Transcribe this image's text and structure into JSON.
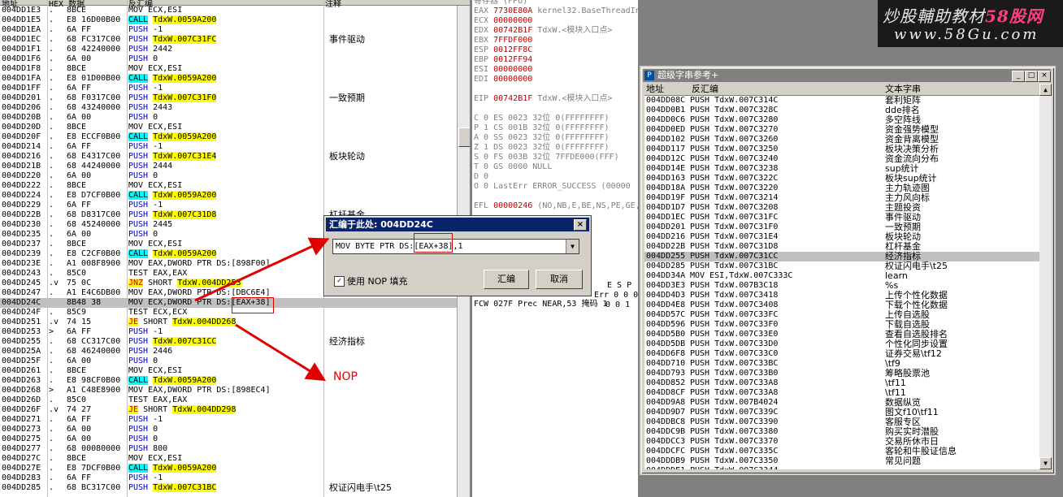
{
  "cpu": {
    "headers": [
      "地址",
      "HEX 数据",
      "反汇编",
      "注释"
    ],
    "rows": [
      {
        "addr": "004DD1E3",
        "flow": ".",
        "hex": "8BCE",
        "k": "",
        "op": "MOV ECX,ESI",
        "tgt": "",
        "c": ""
      },
      {
        "addr": "004DD1E5",
        "flow": ".",
        "hex": "E8 16D00B00",
        "k": "CALL",
        "op": "",
        "tgt": "TdxW.0059A200",
        "c": ""
      },
      {
        "addr": "004DD1EA",
        "flow": ".",
        "hex": "6A FF",
        "k": "PUSH",
        "op": " -1",
        "tgt": "",
        "c": ""
      },
      {
        "addr": "004DD1EC",
        "flow": ".",
        "hex": "68 FC317C00",
        "k": "PUSH",
        "op": "",
        "tgt": "TdxW.007C31FC",
        "c": "事件驱动"
      },
      {
        "addr": "004DD1F1",
        "flow": ".",
        "hex": "68 42240000",
        "k": "PUSH",
        "op": " 2442",
        "tgt": "",
        "c": ""
      },
      {
        "addr": "004DD1F6",
        "flow": ".",
        "hex": "6A 00",
        "k": "PUSH",
        "op": " 0",
        "tgt": "",
        "c": ""
      },
      {
        "addr": "004DD1F8",
        "flow": ".",
        "hex": "8BCE",
        "k": "",
        "op": "MOV ECX,ESI",
        "tgt": "",
        "c": ""
      },
      {
        "addr": "004DD1FA",
        "flow": ".",
        "hex": "E8 01D00B00",
        "k": "CALL",
        "op": "",
        "tgt": "TdxW.0059A200",
        "c": ""
      },
      {
        "addr": "004DD1FF",
        "flow": ".",
        "hex": "6A FF",
        "k": "PUSH",
        "op": " -1",
        "tgt": "",
        "c": ""
      },
      {
        "addr": "004DD201",
        "flow": ".",
        "hex": "68 F0317C00",
        "k": "PUSH",
        "op": "",
        "tgt": "TdxW.007C31F0",
        "c": "一致预期"
      },
      {
        "addr": "004DD206",
        "flow": ".",
        "hex": "68 43240000",
        "k": "PUSH",
        "op": " 2443",
        "tgt": "",
        "c": ""
      },
      {
        "addr": "004DD20B",
        "flow": ".",
        "hex": "6A 00",
        "k": "PUSH",
        "op": " 0",
        "tgt": "",
        "c": ""
      },
      {
        "addr": "004DD20D",
        "flow": ".",
        "hex": "8BCE",
        "k": "",
        "op": "MOV ECX,ESI",
        "tgt": "",
        "c": ""
      },
      {
        "addr": "004DD20F",
        "flow": ".",
        "hex": "E8 ECCF0B00",
        "k": "CALL",
        "op": "",
        "tgt": "TdxW.0059A200",
        "c": ""
      },
      {
        "addr": "004DD214",
        "flow": ".",
        "hex": "6A FF",
        "k": "PUSH",
        "op": " -1",
        "tgt": "",
        "c": ""
      },
      {
        "addr": "004DD216",
        "flow": ".",
        "hex": "68 E4317C00",
        "k": "PUSH",
        "op": "",
        "tgt": "TdxW.007C31E4",
        "c": "板块轮动"
      },
      {
        "addr": "004DD21B",
        "flow": ".",
        "hex": "68 44240000",
        "k": "PUSH",
        "op": " 2444",
        "tgt": "",
        "c": ""
      },
      {
        "addr": "004DD220",
        "flow": ".",
        "hex": "6A 00",
        "k": "PUSH",
        "op": " 0",
        "tgt": "",
        "c": ""
      },
      {
        "addr": "004DD222",
        "flow": ".",
        "hex": "8BCE",
        "k": "",
        "op": "MOV ECX,ESI",
        "tgt": "",
        "c": ""
      },
      {
        "addr": "004DD224",
        "flow": ".",
        "hex": "E8 D7CF0B00",
        "k": "CALL",
        "op": "",
        "tgt": "TdxW.0059A200",
        "c": ""
      },
      {
        "addr": "004DD229",
        "flow": ".",
        "hex": "6A FF",
        "k": "PUSH",
        "op": " -1",
        "tgt": "",
        "c": ""
      },
      {
        "addr": "004DD22B",
        "flow": ".",
        "hex": "68 D8317C00",
        "k": "PUSH",
        "op": "",
        "tgt": "TdxW.007C31D8",
        "c": "杠杆基金"
      },
      {
        "addr": "004DD230",
        "flow": ".",
        "hex": "68 45240000",
        "k": "PUSH",
        "op": " 2445",
        "tgt": "",
        "c": ""
      },
      {
        "addr": "004DD235",
        "flow": ".",
        "hex": "6A 00",
        "k": "PUSH",
        "op": " 0",
        "tgt": "",
        "c": ""
      },
      {
        "addr": "004DD237",
        "flow": ".",
        "hex": "8BCE",
        "k": "",
        "op": "MOV ECX,ESI",
        "tgt": "",
        "c": ""
      },
      {
        "addr": "004DD239",
        "flow": ".",
        "hex": "E8 C2CF0B00",
        "k": "CALL",
        "op": "",
        "tgt": "TdxW.0059A200",
        "c": ""
      },
      {
        "addr": "004DD23E",
        "flow": ".",
        "hex": "A1 008F8900",
        "k": "",
        "op": "MOV EAX,DWORD PTR DS:[898F00]",
        "tgt": "",
        "c": ""
      },
      {
        "addr": "004DD243",
        "flow": ".",
        "hex": "85C0",
        "k": "",
        "op": "TEST EAX,EAX",
        "tgt": "",
        "c": ""
      },
      {
        "addr": "004DD245",
        "flow": ".v",
        "hex": "75 0C",
        "k": "JNZ",
        "op": " SHORT",
        "tgt": "TdxW.004DD253",
        "c": ""
      },
      {
        "addr": "004DD247",
        "flow": ".",
        "hex": "A1 E4C6DB00",
        "k": "",
        "op": "MOV EAX,DWORD PTR DS:[DBC6E4]",
        "tgt": "",
        "c": ""
      },
      {
        "addr": "004DD24C",
        "flow": "",
        "hex": "8B48 38",
        "k": "",
        "op": "MOV ECX,DWORD PTR DS:[EAX+38]",
        "tgt": "",
        "c": "",
        "sel": true
      },
      {
        "addr": "004DD24F",
        "flow": ".",
        "hex": "85C9",
        "k": "",
        "op": "TEST ECX,ECX",
        "tgt": "",
        "c": ""
      },
      {
        "addr": "004DD251",
        "flow": ".v",
        "hex": "74 15",
        "k": "JE",
        "op": " SHORT",
        "tgt": "TdxW.004DD268",
        "c": ""
      },
      {
        "addr": "004DD253",
        "flow": ">",
        "hex": "6A FF",
        "k": "PUSH",
        "op": " -1",
        "tgt": "",
        "c": ""
      },
      {
        "addr": "004DD255",
        "flow": ".",
        "hex": "68 CC317C00",
        "k": "PUSH",
        "op": "",
        "tgt": "TdxW.007C31CC",
        "c": "经济指标"
      },
      {
        "addr": "004DD25A",
        "flow": ".",
        "hex": "68 46240000",
        "k": "PUSH",
        "op": " 2446",
        "tgt": "",
        "c": ""
      },
      {
        "addr": "004DD25F",
        "flow": ".",
        "hex": "6A 00",
        "k": "PUSH",
        "op": " 0",
        "tgt": "",
        "c": ""
      },
      {
        "addr": "004DD261",
        "flow": ".",
        "hex": "8BCE",
        "k": "",
        "op": "MOV ECX,ESI",
        "tgt": "",
        "c": ""
      },
      {
        "addr": "004DD263",
        "flow": ".",
        "hex": "E8 98CF0B00",
        "k": "CALL",
        "op": "",
        "tgt": "TdxW.0059A200",
        "c": ""
      },
      {
        "addr": "004DD268",
        "flow": ">",
        "hex": "A1 C48E8900",
        "k": "",
        "op": "MOV EAX,DWORD PTR DS:[898EC4]",
        "tgt": "",
        "c": ""
      },
      {
        "addr": "004DD26D",
        "flow": ".",
        "hex": "85C0",
        "k": "",
        "op": "TEST EAX,EAX",
        "tgt": "",
        "c": ""
      },
      {
        "addr": "004DD26F",
        "flow": ".v",
        "hex": "74 27",
        "k": "JE",
        "op": " SHORT",
        "tgt": "TdxW.004DD298",
        "c": ""
      },
      {
        "addr": "004DD271",
        "flow": ".",
        "hex": "6A FF",
        "k": "PUSH",
        "op": " -1",
        "tgt": "",
        "c": ""
      },
      {
        "addr": "004DD273",
        "flow": ".",
        "hex": "6A 00",
        "k": "PUSH",
        "op": " 0",
        "tgt": "",
        "c": ""
      },
      {
        "addr": "004DD275",
        "flow": ".",
        "hex": "6A 00",
        "k": "PUSH",
        "op": " 0",
        "tgt": "",
        "c": ""
      },
      {
        "addr": "004DD277",
        "flow": ".",
        "hex": "68 00080000",
        "k": "PUSH",
        "op": " 800",
        "tgt": "",
        "c": ""
      },
      {
        "addr": "004DD27C",
        "flow": ".",
        "hex": "8BCE",
        "k": "",
        "op": "MOV ECX,ESI",
        "tgt": "",
        "c": ""
      },
      {
        "addr": "004DD27E",
        "flow": ".",
        "hex": "E8 7DCF0B00",
        "k": "CALL",
        "op": "",
        "tgt": "TdxW.0059A200",
        "c": ""
      },
      {
        "addr": "004DD283",
        "flow": ".",
        "hex": "6A FF",
        "k": "PUSH",
        "op": " -1",
        "tgt": "",
        "c": ""
      },
      {
        "addr": "004DD285",
        "flow": ".",
        "hex": "68 BC317C00",
        "k": "PUSH",
        "op": "",
        "tgt": "TdxW.007C31BC",
        "c": "权证闪电手\\t25"
      }
    ]
  },
  "registers": {
    "title": "寄存器 (FPU)",
    "lines": [
      {
        "n": "EAX",
        "v": "7730E80A",
        "g": "kernel32.BaseThreadIn"
      },
      {
        "n": "ECX",
        "v": "00000000",
        "g": ""
      },
      {
        "n": "EDX",
        "v": "00742B1F",
        "g": "TdxW.<模块入口点>"
      },
      {
        "n": "EBX",
        "v": "7FFDF000",
        "g": ""
      },
      {
        "n": "ESP",
        "v": "0012FF8C",
        "g": ""
      },
      {
        "n": "EBP",
        "v": "0012FF94",
        "g": ""
      },
      {
        "n": "ESI",
        "v": "00000000",
        "g": ""
      },
      {
        "n": "EDI",
        "v": "00000000",
        "g": ""
      },
      {
        "n": "",
        "v": "",
        "g": ""
      },
      {
        "n": "EIP",
        "v": "00742B1F",
        "g": "TdxW.<模块入口点>"
      },
      {
        "n": "",
        "v": "",
        "g": ""
      },
      {
        "n": "C 0",
        "v": "",
        "g": "ES 0023 32位 0(FFFFFFFF)"
      },
      {
        "n": "P 1",
        "v": "",
        "g": "CS 001B 32位 0(FFFFFFFF)"
      },
      {
        "n": "A 0",
        "v": "",
        "g": "SS 0023 32位 0(FFFFFFFF)"
      },
      {
        "n": "Z 1",
        "v": "",
        "g": "DS 0023 32位 0(FFFFFFFF)"
      },
      {
        "n": "S 0",
        "v": "",
        "g": "FS 003B 32位 7FFDE000(FFF)"
      },
      {
        "n": "T 0",
        "v": "",
        "g": "GS 0000 NULL"
      },
      {
        "n": "D 0",
        "v": "",
        "g": ""
      },
      {
        "n": "O 0",
        "v": "",
        "g": "LastErr ERROR_SUCCESS (00000"
      },
      {
        "n": "",
        "v": "",
        "g": ""
      },
      {
        "n": "EFL",
        "v": "00000246",
        "g": "(NO,NB,E,BE,NS,PE,GE,"
      },
      {
        "n": "",
        "v": "",
        "g": ""
      },
      {
        "n": "ST0",
        "v": "",
        "g": "empty 0.0"
      }
    ],
    "partial1": "E S P",
    "partial2": "Err 0 0 0",
    "partial3": "0 0 1",
    "fcw": "FCW 027F  Prec NEAR,53  掩码    1"
  },
  "watermark": {
    "line1": "炒股輔助教材",
    "brand": "58股网",
    "line2": "www.58Gu.com"
  },
  "strings": {
    "title": "超级字串参考+",
    "headers": [
      "地址",
      "反汇编",
      "文本字串"
    ],
    "rows": [
      {
        "a": "004DD08C",
        "d": "PUSH TdxW.007C314C",
        "t": "套利矩阵"
      },
      {
        "a": "004DD0B1",
        "d": "PUSH TdxW.007C328C",
        "t": "dde排名"
      },
      {
        "a": "004DD0C6",
        "d": "PUSH TdxW.007C3280",
        "t": "多空阵线"
      },
      {
        "a": "004DD0ED",
        "d": "PUSH TdxW.007C3270",
        "t": "资金强势模型"
      },
      {
        "a": "004DD102",
        "d": "PUSH TdxW.007C3260",
        "t": "资金背离模型"
      },
      {
        "a": "004DD117",
        "d": "PUSH TdxW.007C3250",
        "t": "板块决策分析"
      },
      {
        "a": "004DD12C",
        "d": "PUSH TdxW.007C3240",
        "t": "资金流向分布"
      },
      {
        "a": "004DD14E",
        "d": "PUSH TdxW.007C3238",
        "t": "sup统计"
      },
      {
        "a": "004DD163",
        "d": "PUSH TdxW.007C322C",
        "t": "板块sup统计"
      },
      {
        "a": "004DD18A",
        "d": "PUSH TdxW.007C3220",
        "t": "主力轨迹图"
      },
      {
        "a": "004DD19F",
        "d": "PUSH TdxW.007C3214",
        "t": "主力风向标"
      },
      {
        "a": "004DD1D7",
        "d": "PUSH TdxW.007C3208",
        "t": "主题投资"
      },
      {
        "a": "004DD1EC",
        "d": "PUSH TdxW.007C31FC",
        "t": "事件驱动"
      },
      {
        "a": "004DD201",
        "d": "PUSH TdxW.007C31F0",
        "t": "一致预期"
      },
      {
        "a": "004DD216",
        "d": "PUSH TdxW.007C31E4",
        "t": "板块轮动"
      },
      {
        "a": "004DD22B",
        "d": "PUSH TdxW.007C31D8",
        "t": "杠杆基金"
      },
      {
        "a": "004DD255",
        "d": "PUSH TdxW.007C31CC",
        "t": "经济指标",
        "sel": true
      },
      {
        "a": "004DD285",
        "d": "PUSH TdxW.007C31BC",
        "t": "权证闪电手\\t25"
      },
      {
        "a": "004DD34A",
        "d": "MOV ESI,TdxW.007C333C",
        "t": "learn"
      },
      {
        "a": "004DD3E3",
        "d": "PUSH TdxW.007B3C18",
        "t": "%s"
      },
      {
        "a": "004DD4D3",
        "d": "PUSH TdxW.007C3418",
        "t": "上传个性化数据"
      },
      {
        "a": "004DD4E8",
        "d": "PUSH TdxW.007C3408",
        "t": "下载个性化数据"
      },
      {
        "a": "004DD57C",
        "d": "PUSH TdxW.007C33FC",
        "t": "上传自选股"
      },
      {
        "a": "004DD596",
        "d": "PUSH TdxW.007C33F0",
        "t": "下载自选股"
      },
      {
        "a": "004DD5B0",
        "d": "PUSH TdxW.007C33E0",
        "t": "查看自选股排名"
      },
      {
        "a": "004DD5DB",
        "d": "PUSH TdxW.007C33D0",
        "t": "个性化同步设置"
      },
      {
        "a": "004DD6F8",
        "d": "PUSH TdxW.007C33C0",
        "t": "证券交易\\tf12"
      },
      {
        "a": "004DD710",
        "d": "PUSH TdxW.007C33BC",
        "t": "\\tf9"
      },
      {
        "a": "004DD793",
        "d": "PUSH TdxW.007C33B0",
        "t": "筹略股票池"
      },
      {
        "a": "004DD852",
        "d": "PUSH TdxW.007C33A8",
        "t": "\\tf11"
      },
      {
        "a": "004DD8CF",
        "d": "PUSH TdxW.007C33A8",
        "t": "\\tf11"
      },
      {
        "a": "004DD9A8",
        "d": "PUSH TdxW.007B4024",
        "t": "数据纵览"
      },
      {
        "a": "004DD9D7",
        "d": "PUSH TdxW.007C339C",
        "t": "图文f10\\tf11"
      },
      {
        "a": "004DDBC8",
        "d": "PUSH TdxW.007C3390",
        "t": "客服专区"
      },
      {
        "a": "004DDC9B",
        "d": "PUSH TdxW.007C3380",
        "t": "购买实时潜股"
      },
      {
        "a": "004DDCC3",
        "d": "PUSH TdxW.007C3370",
        "t": "交易所休市日"
      },
      {
        "a": "004DDCFC",
        "d": "PUSH TdxW.007C335C",
        "t": "客轮和牛股证信息"
      },
      {
        "a": "004DDDB9",
        "d": "PUSH TdxW.007C3350",
        "t": "常见问题"
      },
      {
        "a": "004DDDE1",
        "d": "PUSH TdxW.007C3344",
        "t": "..."
      }
    ]
  },
  "dialog": {
    "title": "汇编于此处: 004DD24C",
    "value": "MOV BYTE PTR DS:[EAX+38],1",
    "checkbox": "使用 NOP 填充",
    "assemble": "汇编",
    "cancel": "取消"
  },
  "annotation": {
    "nop": "NOP"
  },
  "colors": {
    "accent": "#e00000",
    "call": "#00ffff",
    "jump": "#ffff00",
    "title": "#0a246a"
  }
}
